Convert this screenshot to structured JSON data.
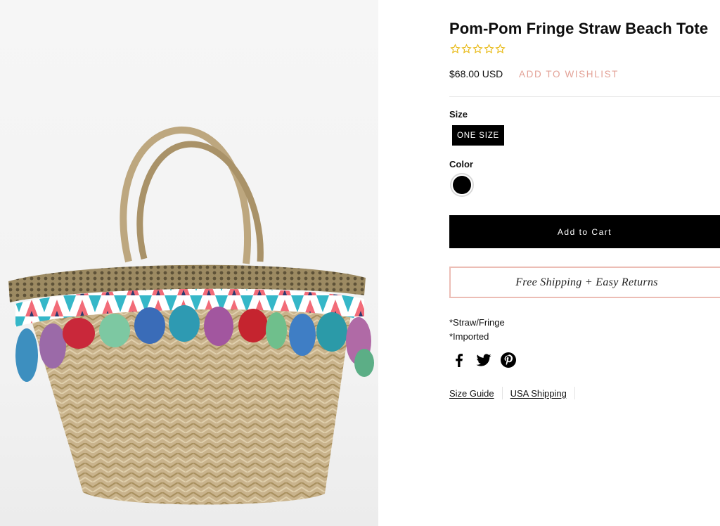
{
  "product": {
    "title": "Pom-Pom Fringe Straw Beach Tote",
    "rating": {
      "value": 0,
      "max": 5
    },
    "price": "$68.00 USD",
    "wishlist_label": "ADD TO WISHLIST"
  },
  "options": {
    "size_label": "Size",
    "size_value": "ONE SIZE",
    "color_label": "Color",
    "color_value": "#000000"
  },
  "actions": {
    "add_to_cart": "Add to Cart"
  },
  "shipping_banner": "Free Shipping + Easy Returns",
  "description": [
    "*Straw/Fringe",
    "*Imported"
  ],
  "social": [
    "facebook-icon",
    "twitter-icon",
    "pinterest-icon"
  ],
  "links": {
    "size_guide": "Size Guide",
    "usa_shipping": "USA Shipping"
  },
  "colors": {
    "accent_pink": "#e3a297",
    "banner_border": "#ecbdb5",
    "star_gold": "#e8b913",
    "button_black": "#000000"
  }
}
